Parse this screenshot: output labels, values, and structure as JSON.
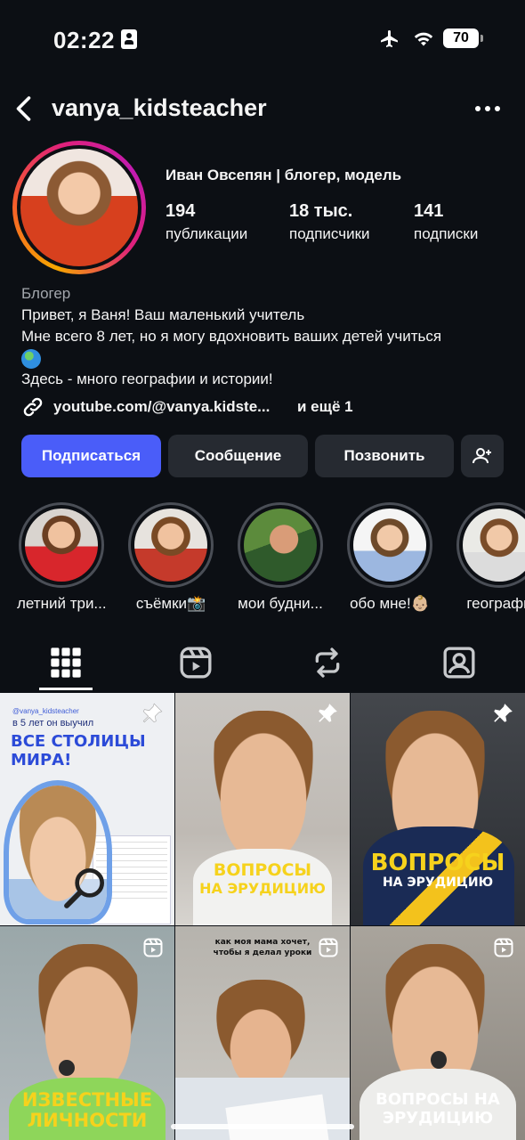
{
  "status": {
    "time": "02:22",
    "battery": "70"
  },
  "header": {
    "username": "vanya_kidsteacher"
  },
  "profile": {
    "fullname": "Иван Овсепян | блогер, модель",
    "stats": [
      {
        "num": "194",
        "label": "публикации"
      },
      {
        "num": "18 тыс.",
        "label": "подписчики"
      },
      {
        "num": "141",
        "label": "подписки"
      }
    ],
    "category": "Блогер",
    "bio_lines": [
      "Привет, я Ваня! Ваш маленький учитель",
      "Мне всего 8 лет, но я могу вдохновить ваших детей учиться",
      "Здесь - много географии и истории!"
    ],
    "link": "youtube.com/@vanya.kidste...",
    "link_more": "и ещё 1"
  },
  "buttons": {
    "follow": "Подписаться",
    "message": "Сообщение",
    "call": "Позвонить"
  },
  "highlights": [
    {
      "label": "летний три..."
    },
    {
      "label": "съёмки📸"
    },
    {
      "label": "мои будни..."
    },
    {
      "label": "обо мне!👶🏼"
    },
    {
      "label": "географи"
    }
  ],
  "posts": [
    {
      "handle": "@vanya_kidsteacher",
      "line1": "в 5 лет он выучил",
      "line2": "ВСЕ СТОЛИЦЫ МИРА!",
      "pinned": true
    },
    {
      "caption1": "ВОПРОСЫ",
      "caption2": "НА ЭРУДИЦИЮ",
      "pinned": true
    },
    {
      "caption1": "ВОПРОСЫ",
      "caption2": "НА ЭРУДИЦИЮ",
      "pinned": true
    },
    {
      "caption1": "ИЗВЕСТНЫЕ",
      "caption2": "ЛИЧНОСТИ",
      "reel": true
    },
    {
      "caption1": "как моя мама хочет,",
      "caption2": "чтобы я делал уроки",
      "reel": true
    },
    {
      "caption1": "ВОПРОСЫ НА",
      "caption2": "ЭРУДИЦИЮ",
      "reel": true
    }
  ],
  "icons": [
    "id-card-icon",
    "airplane-icon",
    "wifi-icon",
    "back-icon",
    "more-icon",
    "link-icon",
    "globe-icon",
    "add-user-icon",
    "grid-icon",
    "reels-icon",
    "repost-icon",
    "tagged-icon",
    "pin-icon",
    "reel-icon"
  ]
}
